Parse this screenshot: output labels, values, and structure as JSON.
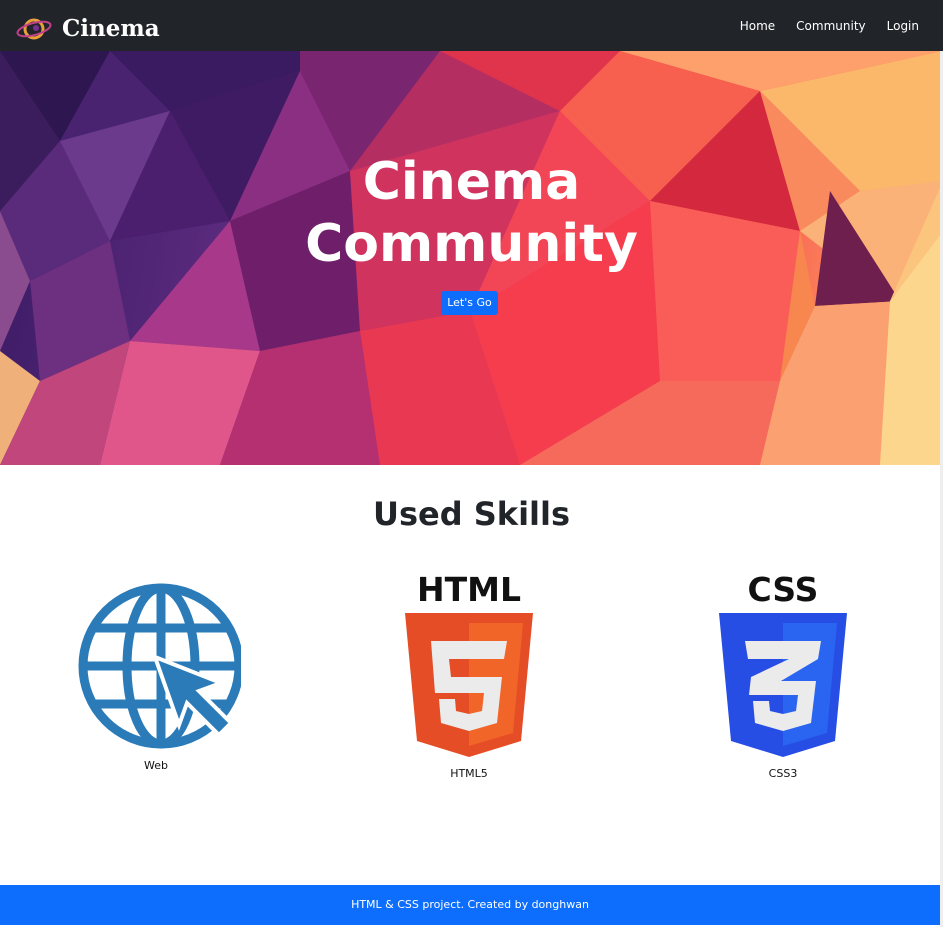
{
  "navbar": {
    "brand": "Cinema",
    "logo_icon": "planet-logo-icon",
    "links": [
      "Home",
      "Community",
      "Login"
    ]
  },
  "hero": {
    "title_line1": "Cinema",
    "title_line2": "Community",
    "button_label": "Let's Go"
  },
  "skills": {
    "title": "Used Skills",
    "items": [
      {
        "label": "Web",
        "icon": "globe-cursor-icon",
        "color": "#2b7bb9"
      },
      {
        "label": "HTML5",
        "icon": "html5-icon",
        "color": "#e44d26",
        "badge_text": "HTML"
      },
      {
        "label": "CSS3",
        "icon": "css3-icon",
        "color": "#264de4",
        "badge_text": "CSS"
      }
    ]
  },
  "footer": {
    "text": "HTML & CSS project. Created by donghwan"
  },
  "colors": {
    "navbar_bg": "#212529",
    "primary": "#0d6efd"
  }
}
